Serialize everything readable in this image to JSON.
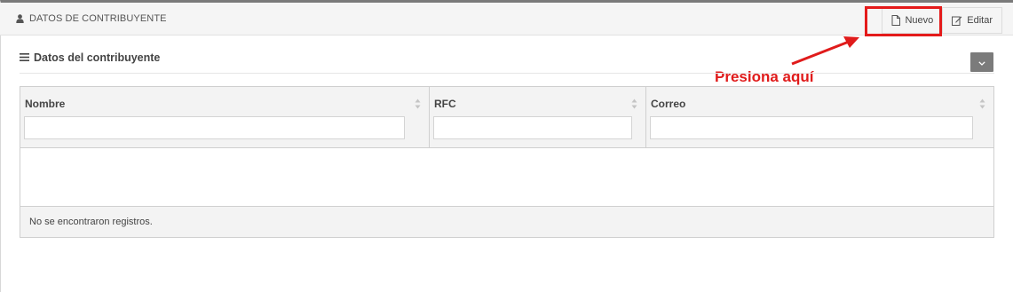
{
  "header": {
    "title": "DATOS DE CONTRIBUYENTE",
    "title_icon": "user-icon"
  },
  "toolbar": {
    "new_label": "Nuevo",
    "new_icon": "file-icon",
    "edit_label": "Editar",
    "edit_icon": "edit-icon"
  },
  "annotation": {
    "text": "Presiona aquí",
    "color": "#e01b1b"
  },
  "section": {
    "title": "Datos del contribuyente",
    "icon": "list-icon",
    "collapse_icon": "chevron-down-icon"
  },
  "table": {
    "columns": [
      {
        "label": "Nombre",
        "filter_value": ""
      },
      {
        "label": "RFC",
        "filter_value": ""
      },
      {
        "label": "Correo",
        "filter_value": ""
      }
    ],
    "rows": [],
    "empty_message": "No se encontraron registros."
  },
  "colors": {
    "highlight": "#e41a1a",
    "header_bg": "#f5f5f5",
    "collapse_button_bg": "#7b7b7b"
  }
}
